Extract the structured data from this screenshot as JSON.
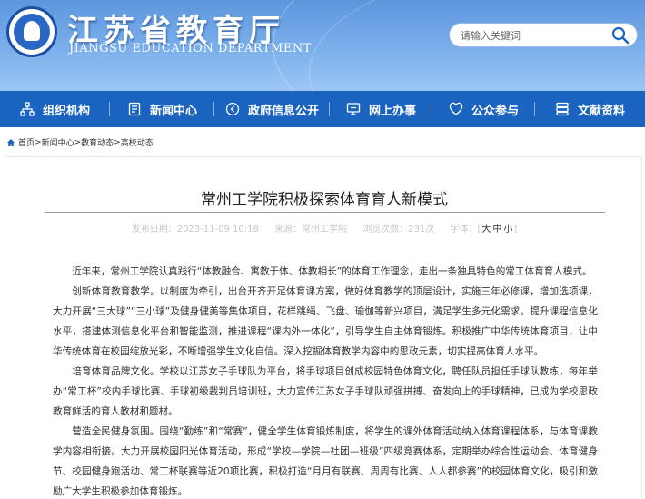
{
  "site": {
    "title": "江苏省教育厅",
    "subtitle": "JIANGSU EDUCATION DEPARTMENT",
    "search_placeholder": "请输入关键词"
  },
  "nav": {
    "items": [
      {
        "label": "组织机构",
        "icon": "org-chart-icon"
      },
      {
        "label": "新闻中心",
        "icon": "document-icon"
      },
      {
        "label": "政府信息公开",
        "icon": "circle-arrow-icon"
      },
      {
        "label": "网上办事",
        "icon": "monitor-icon"
      },
      {
        "label": "公众参与",
        "icon": "heart-icon"
      },
      {
        "label": "文献资料",
        "icon": "archive-icon"
      }
    ]
  },
  "breadcrumb": {
    "home": "首页",
    "sep": ">",
    "items": [
      "新闻中心",
      "教育动态",
      "高校动态"
    ]
  },
  "article": {
    "title": "常州工学院积极探索体育育人新模式",
    "date": "发布日期：2023-11-09 10:18",
    "source": "来源：常州工学院",
    "views": "浏览次数：231次",
    "font_label": "字体：[",
    "font_large": "大",
    "font_mid": "中",
    "font_small": "小",
    "font_close": "]",
    "paragraphs": [
      "近年来，常州工学院认真践行“体教融合、寓教于体、体教相长”的体育工作理念，走出一条独具特色的常工体育育人模式。",
      "创新体育教育教学。以制度为牵引，出台开齐开足体育课方案，做好体育教学的顶层设计，实施三年必修课，增加选项课，大力开展“三大球”“三小球”及健身健美等集体项目，花样跳绳、飞盘、瑜伽等新兴项目，满足学生多元化需求。提升课程信息化水平，搭建体测信息化平台和智能监测，推进课程“课内外一体化”，引导学生自主体育锻炼。积极推广中华传统体育项目，让中华传统体育在校园绽放光彩，不断增强学生文化自信。深入挖掘体育教学内容中的思政元素，切实提高体育人水平。",
      "培育体育品牌文化。学校以江苏女子手球队为平台，将手球项目创成校园特色体育文化，聘任队员担任手球队教练，每年举办“常工杯”校内手球比赛、手球初级裁判员培训班，大力宣传江苏女子手球队顽强拼搏、奋发向上的手球精神，已成为学校思政教育鲜活的育人教材和题材。",
      "营造全民健身氛围。围绕“勤练”和“常赛”，健全学生体育锻炼制度，将学生的课外体育活动纳入体育课程体系，与体育课教学内容相衔接。大力开展校园阳光体育活动，形成“学校—学院—社团—班级”四级竞赛体系，定期举办综合性运动会、体育健身节、校园健身跑活动、常工杯联赛等近20项比赛，积极打造“月月有联赛、周周有比赛、人人都参赛”的校园体育文化，吸引和激励广大学生积极参加体育锻炼。"
    ]
  },
  "colors": {
    "nav_bg": "#1a64c0",
    "header_top": "#5d96dd",
    "header_bottom": "#9cc6f4"
  }
}
